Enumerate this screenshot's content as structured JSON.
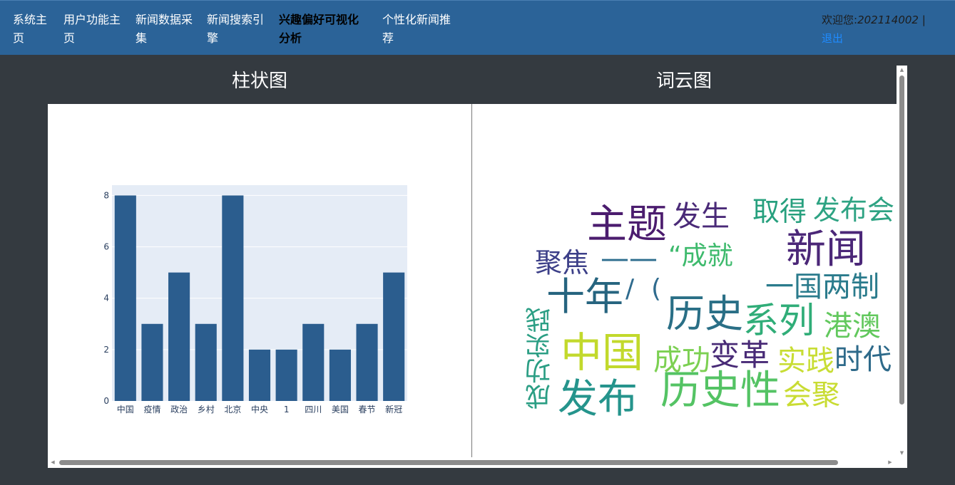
{
  "nav": {
    "items": [
      {
        "line1": "系统主",
        "line2": "页"
      },
      {
        "line1": "用户功能主",
        "line2": "页"
      },
      {
        "line1": "新闻数据采",
        "line2": "集"
      },
      {
        "line1": "新闻搜索引",
        "line2": "擎"
      },
      {
        "line1": "兴趣偏好可视化",
        "line2": "分析",
        "active": true
      },
      {
        "line1": "个性化新闻推",
        "line2": "荐"
      }
    ],
    "welcome_label": "欢迎您:",
    "user_id": "202114002",
    "separator": "|",
    "logout_label": "退出"
  },
  "sections": {
    "bar_title": "柱状图",
    "wordcloud_title": "词云图"
  },
  "chart_data": {
    "type": "bar",
    "categories": [
      "中国",
      "疫情",
      "政治",
      "乡村",
      "北京",
      "中央",
      "1",
      "四川",
      "美国",
      "春节",
      "新冠"
    ],
    "values": [
      8,
      3,
      5,
      3,
      8,
      2,
      2,
      3,
      2,
      3,
      5
    ],
    "yticks": [
      0,
      2,
      4,
      6,
      8
    ],
    "ylim": [
      0,
      8.4
    ],
    "bar_color": "#2b5d8e",
    "plot_bg": "#e5ecf6",
    "grid": true
  },
  "wordcloud": {
    "words": [
      {
        "text": "主题",
        "color": "#4b1c6e"
      },
      {
        "text": "发生",
        "color": "#4a2a78"
      },
      {
        "text": "取得",
        "color": "#27a07e"
      },
      {
        "text": "发布会",
        "color": "#2ea383"
      },
      {
        "text": "新闻",
        "color": "#4b2778"
      },
      {
        "text": "聚焦",
        "color": "#3c3f88"
      },
      {
        "text": "——",
        "color": "#2d6d8e"
      },
      {
        "text": "“成就",
        "color": "#3eba6d"
      },
      {
        "text": "一国两制",
        "color": "#2a7b8c"
      },
      {
        "text": "十年",
        "color": "#26647f"
      },
      {
        "text": "/",
        "color": "#2f6b8e"
      },
      {
        "text": "(",
        "color": "#2f6b8e"
      },
      {
        "text": "历史",
        "color": "#2a6f86"
      },
      {
        "text": "系列",
        "color": "#30ad78"
      },
      {
        "text": "港澳",
        "color": "#62c85d"
      },
      {
        "text": "成功实践",
        "color": "#2b9e84"
      },
      {
        "text": "中国",
        "color": "#c2d92c"
      },
      {
        "text": "成功",
        "color": "#7cd052"
      },
      {
        "text": "变革",
        "color": "#482a76"
      },
      {
        "text": "实践",
        "color": "#c8dd34"
      },
      {
        "text": "时代",
        "color": "#2e6a8a"
      },
      {
        "text": "发布",
        "color": "#25948c"
      },
      {
        "text": "历史性",
        "color": "#54c364"
      },
      {
        "text": "会聚",
        "color": "#c9dc33"
      }
    ]
  }
}
